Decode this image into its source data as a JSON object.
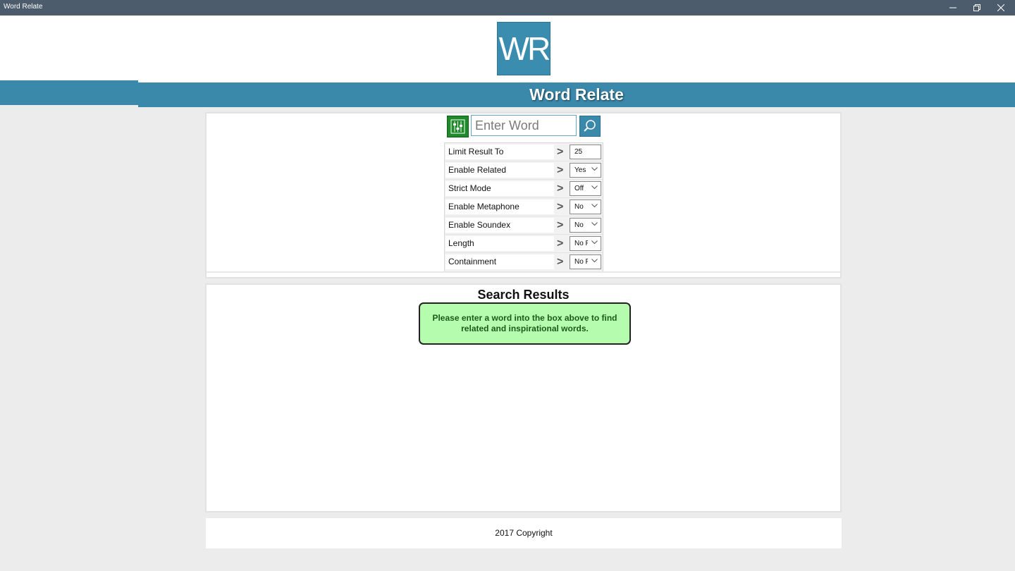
{
  "window": {
    "title": "Word Relate",
    "controls": [
      "minimize",
      "restore",
      "close"
    ]
  },
  "header": {
    "logo_text": "WR",
    "banner_title": "Word Relate",
    "banner_color": "#3a88aa"
  },
  "search": {
    "placeholder": "Enter Word",
    "value": "",
    "filter_icon": "sliders-icon",
    "search_icon": "magnifier-icon"
  },
  "options": [
    {
      "label": "Limit Result To",
      "value": "25",
      "kind": "input"
    },
    {
      "label": "Enable Related",
      "value": "Yes",
      "kind": "select"
    },
    {
      "label": "Strict Mode",
      "value": "Off",
      "kind": "select"
    },
    {
      "label": "Enable Metaphone",
      "value": "No",
      "kind": "select"
    },
    {
      "label": "Enable Soundex",
      "value": "No",
      "kind": "select"
    },
    {
      "label": "Length",
      "value": "No F",
      "kind": "select"
    },
    {
      "label": "Containment",
      "value": "No F",
      "kind": "select"
    }
  ],
  "option_arrow": ">",
  "results": {
    "title": "Search Results",
    "notice": "Please enter a word into the box above to find related and inspirational words.",
    "notice_color": "#b6fcaf"
  },
  "footer": {
    "copyright": "2017 Copyright"
  }
}
